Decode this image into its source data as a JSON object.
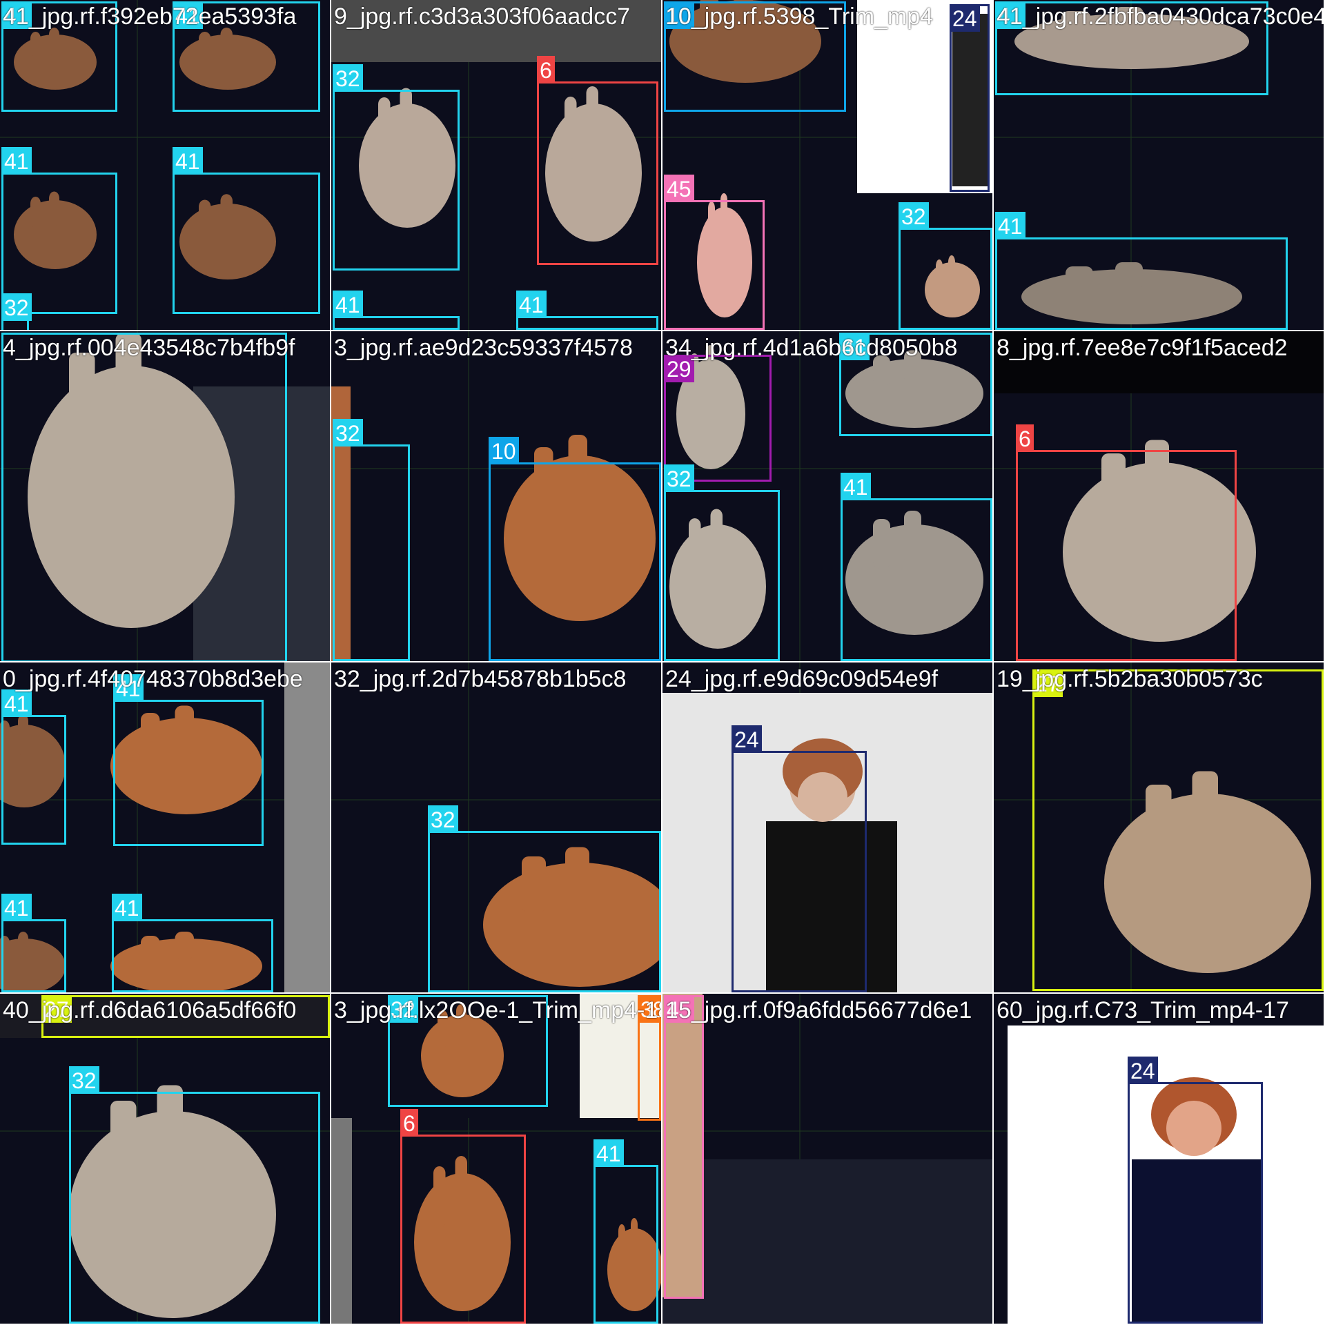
{
  "grid": {
    "columns": 4,
    "rows": 4
  },
  "class_colors": {
    "41": "#22d3ee",
    "32": "#22d3ee",
    "6": "#ef4444",
    "10": "#0ea5e9",
    "45": "#f472b6",
    "24": "#1e2a6e",
    "29": "#a21caf",
    "27": "#d9f210",
    "38": "#f97316"
  },
  "tiles": [
    {
      "filename": "41_jpg.rf.f392eb72ea5393fa",
      "photo": "clasped-hands-grid",
      "boxes": [
        {
          "label": "41"
        },
        {
          "label": "41"
        },
        {
          "label": "41"
        },
        {
          "label": "41"
        },
        {
          "label": "32"
        }
      ]
    },
    {
      "filename": "9_jpg.rf.c3d3a303f06aadcc7",
      "photo": "hand-shapes-grid",
      "boxes": [
        {
          "label": "32"
        },
        {
          "label": "6"
        },
        {
          "label": "41"
        },
        {
          "label": "41"
        }
      ]
    },
    {
      "filename": "10_jpg.rf.5398_Trim_mp4",
      "photo": "mixed-signs",
      "boxes": [
        {
          "label": "10"
        },
        {
          "label": "24"
        },
        {
          "label": "45"
        },
        {
          "label": "32"
        }
      ]
    },
    {
      "filename": "41_jpg.rf.2fbfba0430dca73c0e4",
      "photo": "clasped-hands-blur",
      "boxes": [
        {
          "label": "41"
        },
        {
          "label": "41"
        }
      ]
    },
    {
      "filename": "4_jpg.rf.004e43548c7b4fb9f",
      "photo": "hand-closeup",
      "boxes": [
        {
          "label": ""
        }
      ]
    },
    {
      "filename": "3_jpg.rf.ae9d23c59337f4578",
      "photo": "hand-orange",
      "boxes": [
        {
          "label": "32"
        },
        {
          "label": "10"
        }
      ]
    },
    {
      "filename": "34_jpg.rf.4d1a6b6cd8050b8",
      "photo": "mixed-grey",
      "boxes": [
        {
          "label": "29"
        },
        {
          "label": "41"
        },
        {
          "label": "32"
        },
        {
          "label": "41"
        }
      ]
    },
    {
      "filename": "8_jpg.rf.7ee8e7c9f1f5aced2",
      "photo": "c-hand",
      "boxes": [
        {
          "label": "6"
        }
      ]
    },
    {
      "filename": "0_jpg.rf.4f40748370b8d3ebe",
      "photo": "clasped-dark",
      "boxes": [
        {
          "label": "41"
        },
        {
          "label": "41"
        },
        {
          "label": "41"
        },
        {
          "label": "41"
        }
      ]
    },
    {
      "filename": "32_jpg.rf.2d7b45878b1b5c8",
      "photo": "hand-orange-low",
      "boxes": [
        {
          "label": "32"
        }
      ]
    },
    {
      "filename": "24_jpg.rf.e9d69c09d54e9f",
      "photo": "woman-signing",
      "boxes": [
        {
          "label": "24"
        }
      ]
    },
    {
      "filename": "19_jpg.rf.5b2ba30b0573c",
      "photo": "l-hand",
      "boxes": [
        {
          "label": "27"
        }
      ]
    },
    {
      "filename": "40_jpg.rf.d6da6106a5df66f0",
      "photo": "hand-closeup-2",
      "boxes": [
        {
          "label": "27"
        },
        {
          "label": "32"
        }
      ]
    },
    {
      "filename": "3_jpg.rf.lx2OOe-1_Trim_mp4-18",
      "photo": "mixed-orange",
      "boxes": [
        {
          "label": "32"
        },
        {
          "label": "38"
        },
        {
          "label": "6"
        },
        {
          "label": "41"
        }
      ]
    },
    {
      "filename": "15_jpg.rf.0f9a6fdd56677d6e1",
      "photo": "dark-fabric",
      "boxes": [
        {
          "label": "45"
        }
      ]
    },
    {
      "filename": "60_jpg.rf.C73_Trim_mp4-17",
      "photo": "woman-signing-white",
      "boxes": [
        {
          "label": "24"
        }
      ]
    }
  ]
}
